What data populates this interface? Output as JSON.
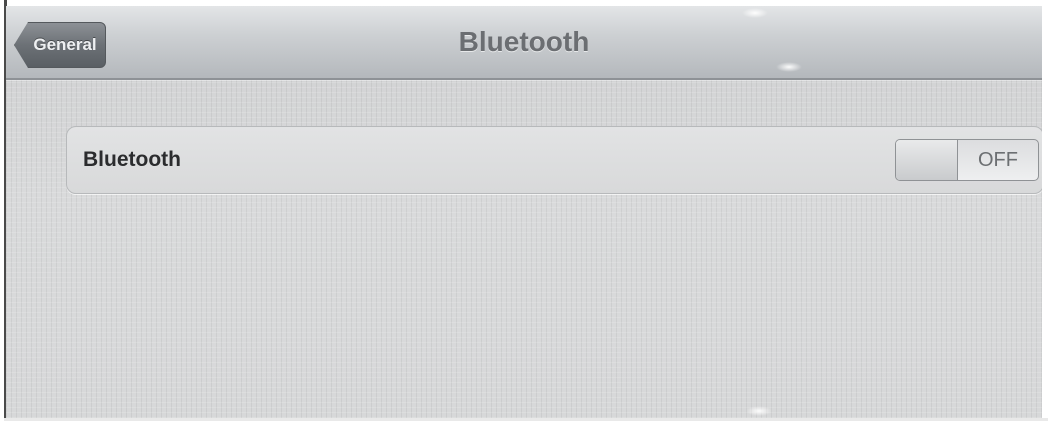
{
  "navbar": {
    "back_label": "General",
    "title": "Bluetooth"
  },
  "settings": {
    "rows": [
      {
        "label": "Bluetooth",
        "toggle_state": "OFF"
      }
    ]
  },
  "colors": {
    "background": "#d4d5d6",
    "navbar": "#c8cbce",
    "back_button": "#6c7176",
    "title_text": "#6b6e72",
    "group_background": "#dcdddf",
    "label_text": "#2b2c2e"
  }
}
